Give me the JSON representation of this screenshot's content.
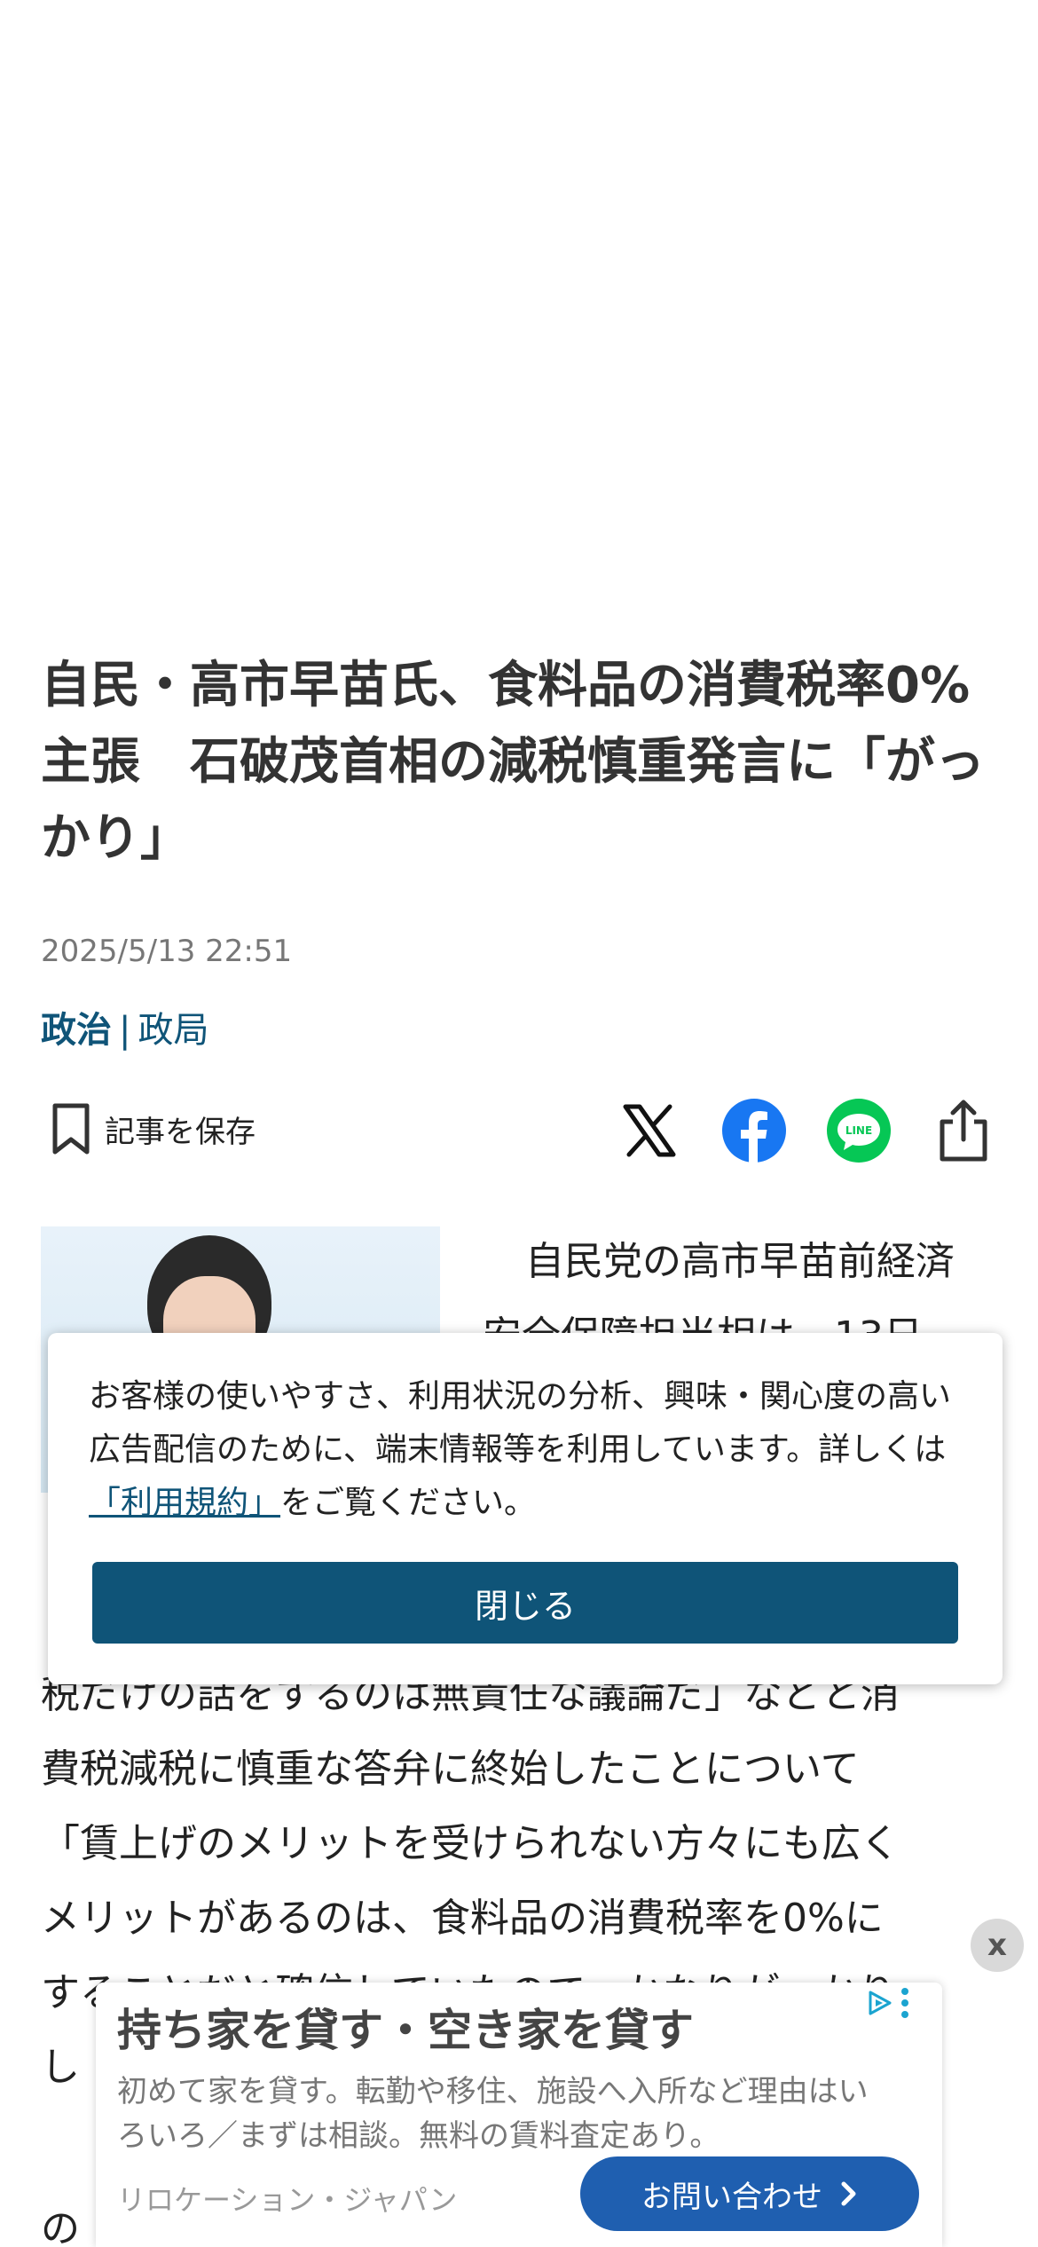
{
  "article": {
    "headline": "自民・高市早苗氏、食料品の消費税率0%主張　石破茂首相の減税慎重発言に「がっかり」",
    "datetime": "2025/5/13 22:51",
    "category_main": "政治",
    "category_separator": "|",
    "category_sub": "政局",
    "lead_line_1": "自民党の高市早苗前経済",
    "lead_line_2": "安全保障担当相は、13日",
    "body_lines": [
      "税だけの話をするのは無責任な議論だ」などと消",
      "費税減税に慎重な答弁に終始したことについて",
      "「賃上げのメリットを受けられない方々にも広く",
      "メリットがあるのは、食料品の消費税率を0%に",
      "することだと確信していたので、かなりがっかり",
      "し",
      "　",
      "の"
    ]
  },
  "toolbar": {
    "save_label": "記事を保存",
    "icons": [
      "bookmark-icon",
      "x-icon",
      "facebook-icon",
      "line-icon",
      "share-icon"
    ],
    "line_icon_text": "LINE",
    "colors": {
      "facebook": "#1877f2",
      "line": "#06c755"
    }
  },
  "consent": {
    "text_before": "お客様の使いやすさ、利用状況の分析、興味・関心度の高い広告配信のために、端末情報等を利用しています。詳しくは",
    "link_text": "「利用規約」",
    "text_after": "をご覧ください。",
    "close_label": "閉じる",
    "accent_color": "#0f5478"
  },
  "ad": {
    "close_label": "x",
    "title": "持ち家を貸す・空き家を貸す",
    "description": "初めて家を貸す。転勤や移住、施設へ入所など理由はいろいろ／まずは相談。無料の賃料査定あり。",
    "sponsor": "リロケーション・ジャパン",
    "cta_label": "お問い合わせ",
    "cta_color": "#1f5fb0"
  }
}
